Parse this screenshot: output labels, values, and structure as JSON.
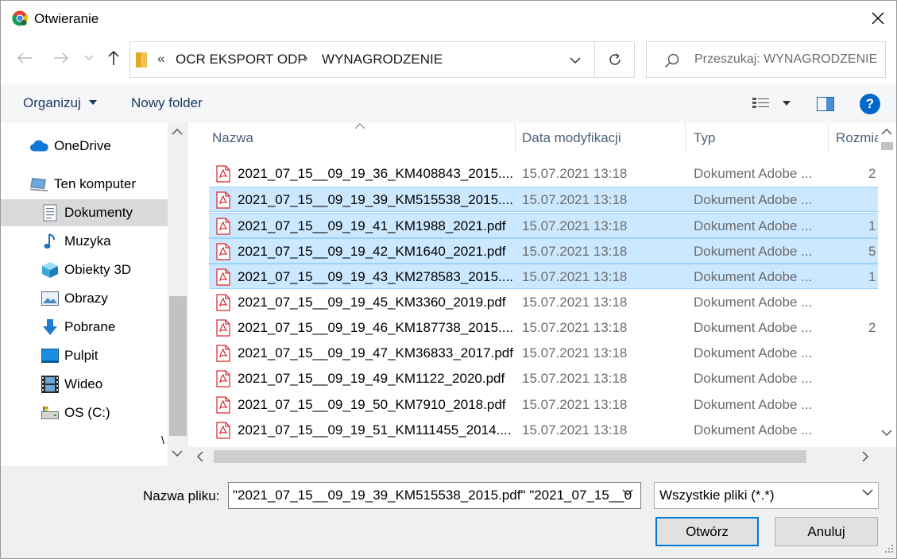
{
  "window": {
    "title": "Otwieranie",
    "close_glyph": "✕"
  },
  "address": {
    "overflow": "«",
    "path": [
      "OCR EKSPORT ODP",
      "WYNAGRODZENIE"
    ],
    "separator": "›"
  },
  "search": {
    "placeholder": "Przeszukaj: WYNAGRODZENIE"
  },
  "toolbar": {
    "organize_label": "Organizuj",
    "new_folder_label": "Nowy folder",
    "help_glyph": "?"
  },
  "nav": {
    "items": [
      {
        "label": "OneDrive",
        "icon": "cloud-icon",
        "selected": false
      },
      {
        "label": "Ten komputer",
        "icon": "computer-icon",
        "selected": false
      },
      {
        "label": "Dokumenty",
        "icon": "documents-icon",
        "selected": true
      },
      {
        "label": "Muzyka",
        "icon": "music-icon",
        "selected": false
      },
      {
        "label": "Obiekty 3D",
        "icon": "cube-icon",
        "selected": false
      },
      {
        "label": "Obrazy",
        "icon": "pictures-icon",
        "selected": false
      },
      {
        "label": "Pobrane",
        "icon": "download-icon",
        "selected": false
      },
      {
        "label": "Pulpit",
        "icon": "desktop-icon",
        "selected": false
      },
      {
        "label": "Wideo",
        "icon": "video-icon",
        "selected": false
      },
      {
        "label": "OS (C:)",
        "icon": "drive-icon",
        "selected": false
      }
    ],
    "tail_text": "\\"
  },
  "columns": {
    "name": "Nazwa",
    "date": "Data modyfikacji",
    "type": "Typ",
    "size": "Rozmia"
  },
  "files": [
    {
      "name": "2021_07_15__09_19_36_KM408843_2015....",
      "date": "15.07.2021 13:18",
      "type": "Dokument Adobe ...",
      "size": "2",
      "selected": false
    },
    {
      "name": "2021_07_15__09_19_39_KM515538_2015....",
      "date": "15.07.2021 13:18",
      "type": "Dokument Adobe ...",
      "size": "",
      "selected": true
    },
    {
      "name": "2021_07_15__09_19_41_KM1988_2021.pdf",
      "date": "15.07.2021 13:18",
      "type": "Dokument Adobe ...",
      "size": "1",
      "selected": true
    },
    {
      "name": "2021_07_15__09_19_42_KM1640_2021.pdf",
      "date": "15.07.2021 13:18",
      "type": "Dokument Adobe ...",
      "size": "5",
      "selected": true
    },
    {
      "name": "2021_07_15__09_19_43_KM278583_2015....",
      "date": "15.07.2021 13:18",
      "type": "Dokument Adobe ...",
      "size": "1",
      "selected": true
    },
    {
      "name": "2021_07_15__09_19_45_KM3360_2019.pdf",
      "date": "15.07.2021 13:18",
      "type": "Dokument Adobe ...",
      "size": "",
      "selected": false
    },
    {
      "name": "2021_07_15__09_19_46_KM187738_2015....",
      "date": "15.07.2021 13:18",
      "type": "Dokument Adobe ...",
      "size": "2",
      "selected": false
    },
    {
      "name": "2021_07_15__09_19_47_KM36833_2017.pdf",
      "date": "15.07.2021 13:18",
      "type": "Dokument Adobe ...",
      "size": "",
      "selected": false
    },
    {
      "name": "2021_07_15__09_19_49_KM1122_2020.pdf",
      "date": "15.07.2021 13:18",
      "type": "Dokument Adobe ...",
      "size": "",
      "selected": false
    },
    {
      "name": "2021_07_15__09_19_50_KM7910_2018.pdf",
      "date": "15.07.2021 13:18",
      "type": "Dokument Adobe ...",
      "size": "",
      "selected": false
    },
    {
      "name": "2021_07_15__09_19_51_KM111455_2014....",
      "date": "15.07.2021 13:18",
      "type": "Dokument Adobe ...",
      "size": "",
      "selected": false
    }
  ],
  "footer": {
    "filename_label": "Nazwa pliku:",
    "filename_value": "\"2021_07_15__09_19_39_KM515538_2015.pdf\" \"2021_07_15__0",
    "filetype_value": "Wszystkie pliki (*.*)",
    "open_label": "Otwórz",
    "cancel_label": "Anuluj"
  },
  "colors": {
    "selection_fill": "#cce8ff",
    "selection_border": "#99d1ff",
    "accent": "#0078d7",
    "pdf_red": "#d9262a"
  }
}
